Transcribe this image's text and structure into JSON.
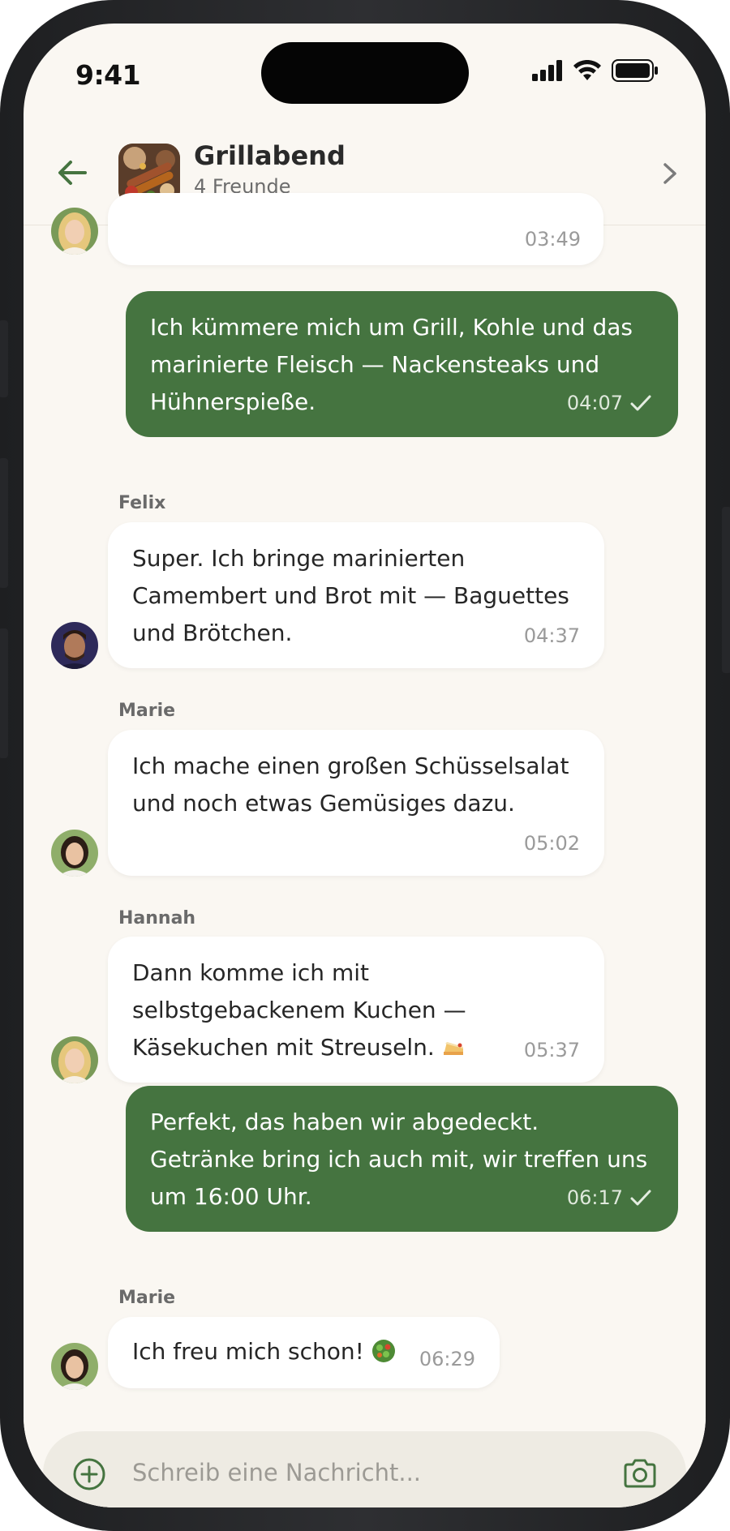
{
  "status_bar": {
    "time": "9:41"
  },
  "header": {
    "title": "Grillabend",
    "subtitle": "4 Freunde"
  },
  "messages": [
    {
      "id": "m0",
      "direction": "in",
      "avatar": "blonde-woman",
      "time": "03:49"
    },
    {
      "id": "m1",
      "direction": "out",
      "text": "Ich kümmere mich um Grill, Kohle und das\nmarinierte Fleisch — Nackensteaks und\nHühnerspieße.",
      "time": "04:07",
      "read": true
    },
    {
      "id": "m2",
      "direction": "in",
      "sender": "Felix",
      "avatar": "man",
      "text": "Super. Ich bringe marinierten\nCamembert und Brot mit — Baguettes\nund Brötchen.",
      "time": "04:37"
    },
    {
      "id": "m3",
      "direction": "in",
      "sender": "Marie",
      "avatar": "dark-haired-woman",
      "text": "Ich mache einen großen Schüsselsalat\nund noch etwas Gemüsiges dazu.",
      "time": "05:02"
    },
    {
      "id": "m4",
      "direction": "in",
      "sender": "Hannah",
      "avatar": "blonde-woman",
      "text": "Dann komme ich mit\nselbstgebackenem Kuchen —\nKäsekuchen mit Streuseln.",
      "emoji": "cake",
      "time": "05:37"
    },
    {
      "id": "m5",
      "direction": "out",
      "text": "Perfekt, das haben wir abgedeckt.\nGetränke bring ich auch mit, wir treffen uns\num 16:00 Uhr.",
      "time": "06:17",
      "read": true
    },
    {
      "id": "m6",
      "direction": "in",
      "sender": "Marie",
      "avatar": "dark-haired-woman",
      "text": "Ich freu mich schon!",
      "emoji": "salad",
      "time": "06:29"
    }
  ],
  "composer": {
    "placeholder": "Schreib eine Nachricht..."
  },
  "colors": {
    "accent": "#457440",
    "background": "#faf7f2",
    "incoming_bubble": "#ffffff"
  }
}
